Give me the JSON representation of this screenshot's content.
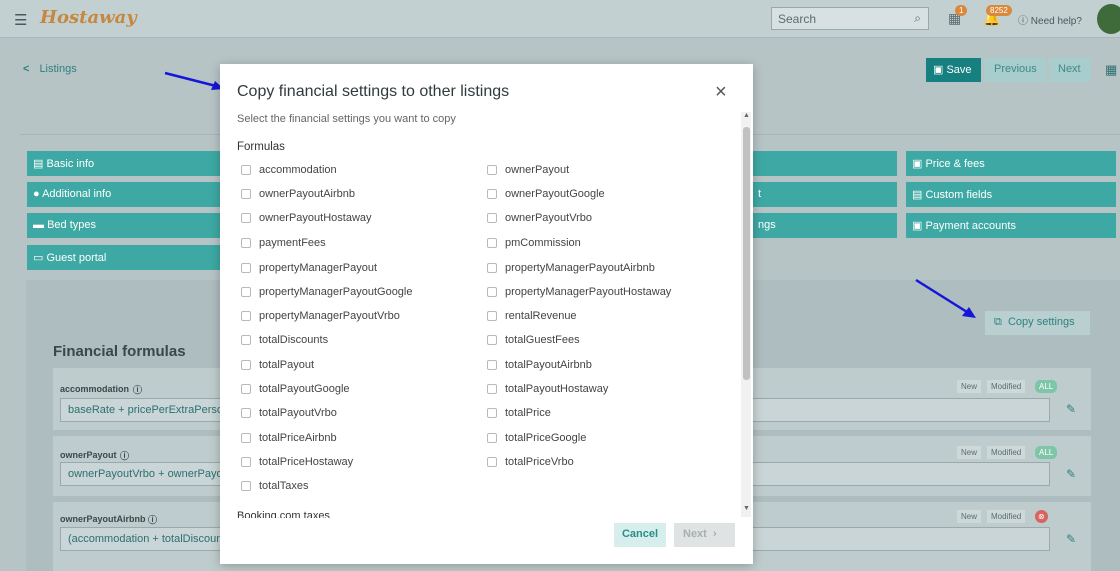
{
  "app": {
    "logo": "Hostaway"
  },
  "header": {
    "search_placeholder": "Search",
    "calendar_badge": "1",
    "notification_badge": "8252",
    "help_label": "Need help?"
  },
  "page": {
    "breadcrumb": "Listings",
    "save_label": "Save",
    "previous_label": "Previous",
    "next_label": "Next"
  },
  "nav_tabs_left": [
    "Basic info",
    "Additional info",
    "Bed types",
    "Guest portal"
  ],
  "nav_tabs_mid": [
    "t",
    "ngs"
  ],
  "nav_tabs_right": [
    "Price & fees",
    "Custom fields",
    "Payment accounts"
  ],
  "copy_settings_label": "Copy settings",
  "financial_title": "Financial formulas",
  "formulas": [
    {
      "label": "accommodation",
      "value": "baseRate + pricePerExtraPerson"
    },
    {
      "label": "ownerPayout",
      "value": "ownerPayoutVrbo + ownerPayou"
    },
    {
      "label": "ownerPayoutAirbnb",
      "value": "(accommodation + totalDiscount"
    }
  ],
  "chips": {
    "new": "New",
    "modified": "Modified",
    "all": "ALL"
  },
  "modal": {
    "title": "Copy financial settings to other listings",
    "subtitle": "Select the financial settings you want to copy",
    "section": "Formulas",
    "next_section": "Booking.com taxes",
    "left_options": [
      "accommodation",
      "ownerPayoutAirbnb",
      "ownerPayoutHostaway",
      "paymentFees",
      "propertyManagerPayout",
      "propertyManagerPayoutGoogle",
      "propertyManagerPayoutVrbo",
      "totalDiscounts",
      "totalPayout",
      "totalPayoutGoogle",
      "totalPayoutVrbo",
      "totalPriceAirbnb",
      "totalPriceHostaway",
      "totalTaxes"
    ],
    "right_options": [
      "ownerPayout",
      "ownerPayoutGoogle",
      "ownerPayoutVrbo",
      "pmCommission",
      "propertyManagerPayoutAirbnb",
      "propertyManagerPayoutHostaway",
      "rentalRevenue",
      "totalGuestFees",
      "totalPayoutAirbnb",
      "totalPayoutHostaway",
      "totalPrice",
      "totalPriceGoogle",
      "totalPriceVrbo"
    ],
    "cancel_label": "Cancel",
    "next_label": "Next"
  }
}
